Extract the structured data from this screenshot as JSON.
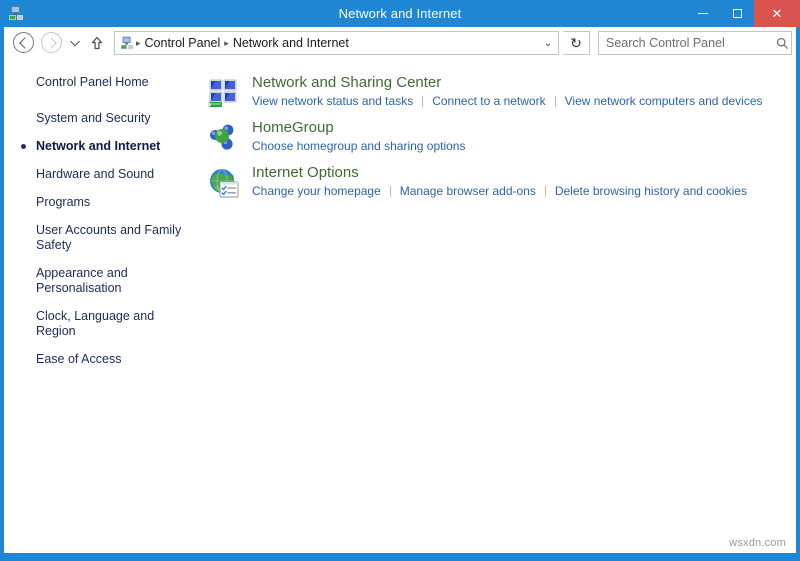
{
  "window": {
    "title": "Network and Internet",
    "icon": "control-panel-network-icon",
    "accent_color": "#1f86d4",
    "close_color": "#d9534f",
    "controls": {
      "minimize_label": "Minimize",
      "maximize_label": "Maximize",
      "close_label": "Close"
    }
  },
  "toolbar": {
    "back_label": "Back",
    "forward_label": "Forward",
    "recent_label": "Recent locations",
    "up_label": "Up one level",
    "refresh_label": "Refresh",
    "breadcrumb": {
      "icon": "control-panel-icon",
      "separator": "▸",
      "items": [
        {
          "label": "Control Panel"
        },
        {
          "label": "Network and Internet"
        }
      ],
      "dropdown_glyph": "⌄"
    },
    "search": {
      "placeholder": "Search Control Panel",
      "value": "",
      "icon": "search-icon"
    }
  },
  "sidebar": {
    "items": [
      {
        "label": "Control Panel Home",
        "current": false,
        "home": true
      },
      {
        "label": "System and Security",
        "current": false
      },
      {
        "label": "Network and Internet",
        "current": true
      },
      {
        "label": "Hardware and Sound",
        "current": false
      },
      {
        "label": "Programs",
        "current": false
      },
      {
        "label": "User Accounts and Family Safety",
        "current": false
      },
      {
        "label": "Appearance and Personalisation",
        "current": false
      },
      {
        "label": "Clock, Language and Region",
        "current": false
      },
      {
        "label": "Ease of Access",
        "current": false
      }
    ]
  },
  "main": {
    "heading_color": "#3f6b32",
    "link_color": "#2b63ad",
    "categories": [
      {
        "title": "Network and Sharing Center",
        "icon": "network-sharing-center-icon",
        "links": [
          "View network status and tasks",
          "Connect to a network",
          "View network computers and devices"
        ]
      },
      {
        "title": "HomeGroup",
        "icon": "homegroup-icon",
        "links": [
          "Choose homegroup and sharing options"
        ]
      },
      {
        "title": "Internet Options",
        "icon": "internet-options-icon",
        "links": [
          "Change your homepage",
          "Manage browser add-ons",
          "Delete browsing history and cookies"
        ]
      }
    ]
  },
  "watermark": {
    "text": "wsxdn.com"
  }
}
